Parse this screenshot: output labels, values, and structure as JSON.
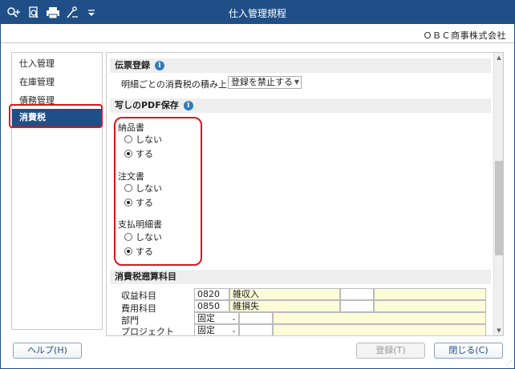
{
  "window": {
    "title": "仕入管理規程",
    "company": "ＯＢＣ商事株式会社"
  },
  "toolbar": {
    "icons": [
      "search-plus-icon",
      "search-doc-icon",
      "printer-icon",
      "tools-icon",
      "dropdown-icon"
    ]
  },
  "nav": {
    "items": [
      {
        "label": "仕入管理",
        "active": false
      },
      {
        "label": "在庫管理",
        "active": false
      },
      {
        "label": "債務管理",
        "active": false
      },
      {
        "label": "消費税",
        "active": true
      }
    ]
  },
  "sections": {
    "denpyo": {
      "title": "伝票登録",
      "row_label": "明細ごとの消費税の積み上げ",
      "select_value": "登録を禁止する"
    },
    "pdf": {
      "title": "写しのPDF保存",
      "groups": [
        {
          "label": "納品書",
          "options": [
            {
              "label": "しない",
              "checked": false
            },
            {
              "label": "する",
              "checked": true
            }
          ]
        },
        {
          "label": "注文書",
          "options": [
            {
              "label": "しない",
              "checked": false
            },
            {
              "label": "する",
              "checked": true
            }
          ]
        },
        {
          "label": "支払明細書",
          "options": [
            {
              "label": "しない",
              "checked": false
            },
            {
              "label": "する",
              "checked": true
            }
          ]
        }
      ]
    },
    "accounts": {
      "title": "消費税遡算科目",
      "rows": [
        {
          "label": "収益科目",
          "code": "0820",
          "name": "雑収入"
        },
        {
          "label": "費用科目",
          "code": "0850",
          "name": "雑損失"
        },
        {
          "label": "部門",
          "mode": "固定"
        },
        {
          "label": "プロジェクト",
          "mode": "固定"
        }
      ]
    }
  },
  "buttons": {
    "help": "ヘルプ(H)",
    "register": "登録(T)",
    "close": "閉じる(C)"
  },
  "colors": {
    "accent": "#1f4f86",
    "highlight": "#e0141b",
    "info": "#2f7cc2"
  }
}
